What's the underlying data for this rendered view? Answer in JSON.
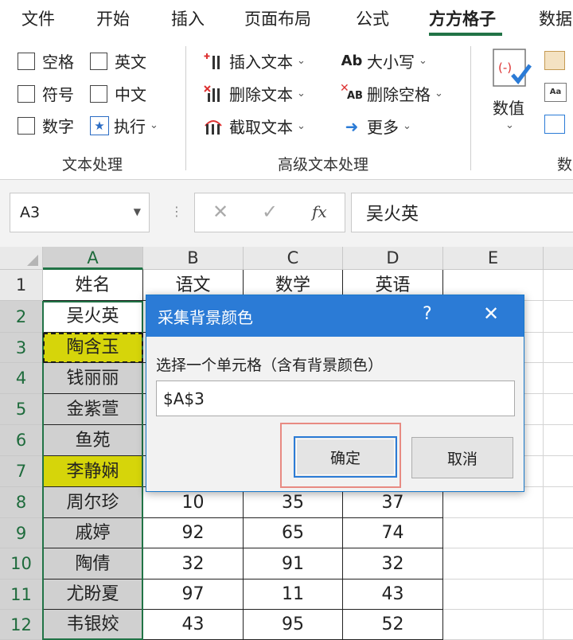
{
  "menu": {
    "tabs": [
      {
        "label": "文件"
      },
      {
        "label": "开始"
      },
      {
        "label": "插入"
      },
      {
        "label": "页面布局"
      },
      {
        "label": "公式"
      },
      {
        "label": "方方格子"
      },
      {
        "label": "数据"
      }
    ],
    "active_tab": "方方格子",
    "accent_color": "#217346"
  },
  "ribbon": {
    "text_group": {
      "label": "文本处理",
      "checkboxes": [
        "空格",
        "英文",
        "符号",
        "中文",
        "数字"
      ],
      "execute": "执行"
    },
    "advanced_group": {
      "label": "高级文本处理",
      "items": [
        "插入文本",
        "删除文本",
        "截取文本",
        "大小写",
        "删除空格",
        "更多"
      ]
    },
    "number_group": {
      "label": "数",
      "big_button": "数值"
    }
  },
  "formula_bar": {
    "name_box": "A3",
    "cancel_symbol": "✕",
    "confirm_symbol": "✓",
    "fx_label": "fx",
    "value": "吴火英"
  },
  "sheet": {
    "columns": [
      "A",
      "B",
      "C",
      "D",
      "E"
    ],
    "rows": [
      {
        "num": "1",
        "cells": [
          "姓名",
          "语文",
          "数学",
          "英语",
          ""
        ]
      },
      {
        "num": "2",
        "cells": [
          "吴火英",
          "",
          "",
          "",
          ""
        ]
      },
      {
        "num": "3",
        "cells": [
          "陶含玉",
          "",
          "",
          "",
          ""
        ]
      },
      {
        "num": "4",
        "cells": [
          "钱丽丽",
          "",
          "",
          "",
          ""
        ]
      },
      {
        "num": "5",
        "cells": [
          "金紫萱",
          "",
          "",
          "",
          ""
        ]
      },
      {
        "num": "6",
        "cells": [
          "鱼苑",
          "",
          "",
          "",
          ""
        ]
      },
      {
        "num": "7",
        "cells": [
          "李静娴",
          "",
          "",
          "",
          ""
        ]
      },
      {
        "num": "8",
        "cells": [
          "周尔珍",
          "10",
          "35",
          "37",
          ""
        ]
      },
      {
        "num": "9",
        "cells": [
          "戚婷",
          "92",
          "65",
          "74",
          ""
        ]
      },
      {
        "num": "10",
        "cells": [
          "陶倩",
          "32",
          "91",
          "32",
          ""
        ]
      },
      {
        "num": "11",
        "cells": [
          "尤盼夏",
          "97",
          "11",
          "43",
          ""
        ]
      },
      {
        "num": "12",
        "cells": [
          "韦银姣",
          "43",
          "95",
          "52",
          ""
        ]
      }
    ],
    "fill_colors": {
      "gray": "#d0d0d0",
      "yellow": "#d6d50a"
    }
  },
  "dialog": {
    "title": "采集背景颜色",
    "help": "?",
    "close": "✕",
    "label": "选择一个单元格（含有背景颜色）",
    "input_value": "$A$3",
    "ok": "确定",
    "cancel": "取消",
    "title_color": "#2b7bd6"
  }
}
